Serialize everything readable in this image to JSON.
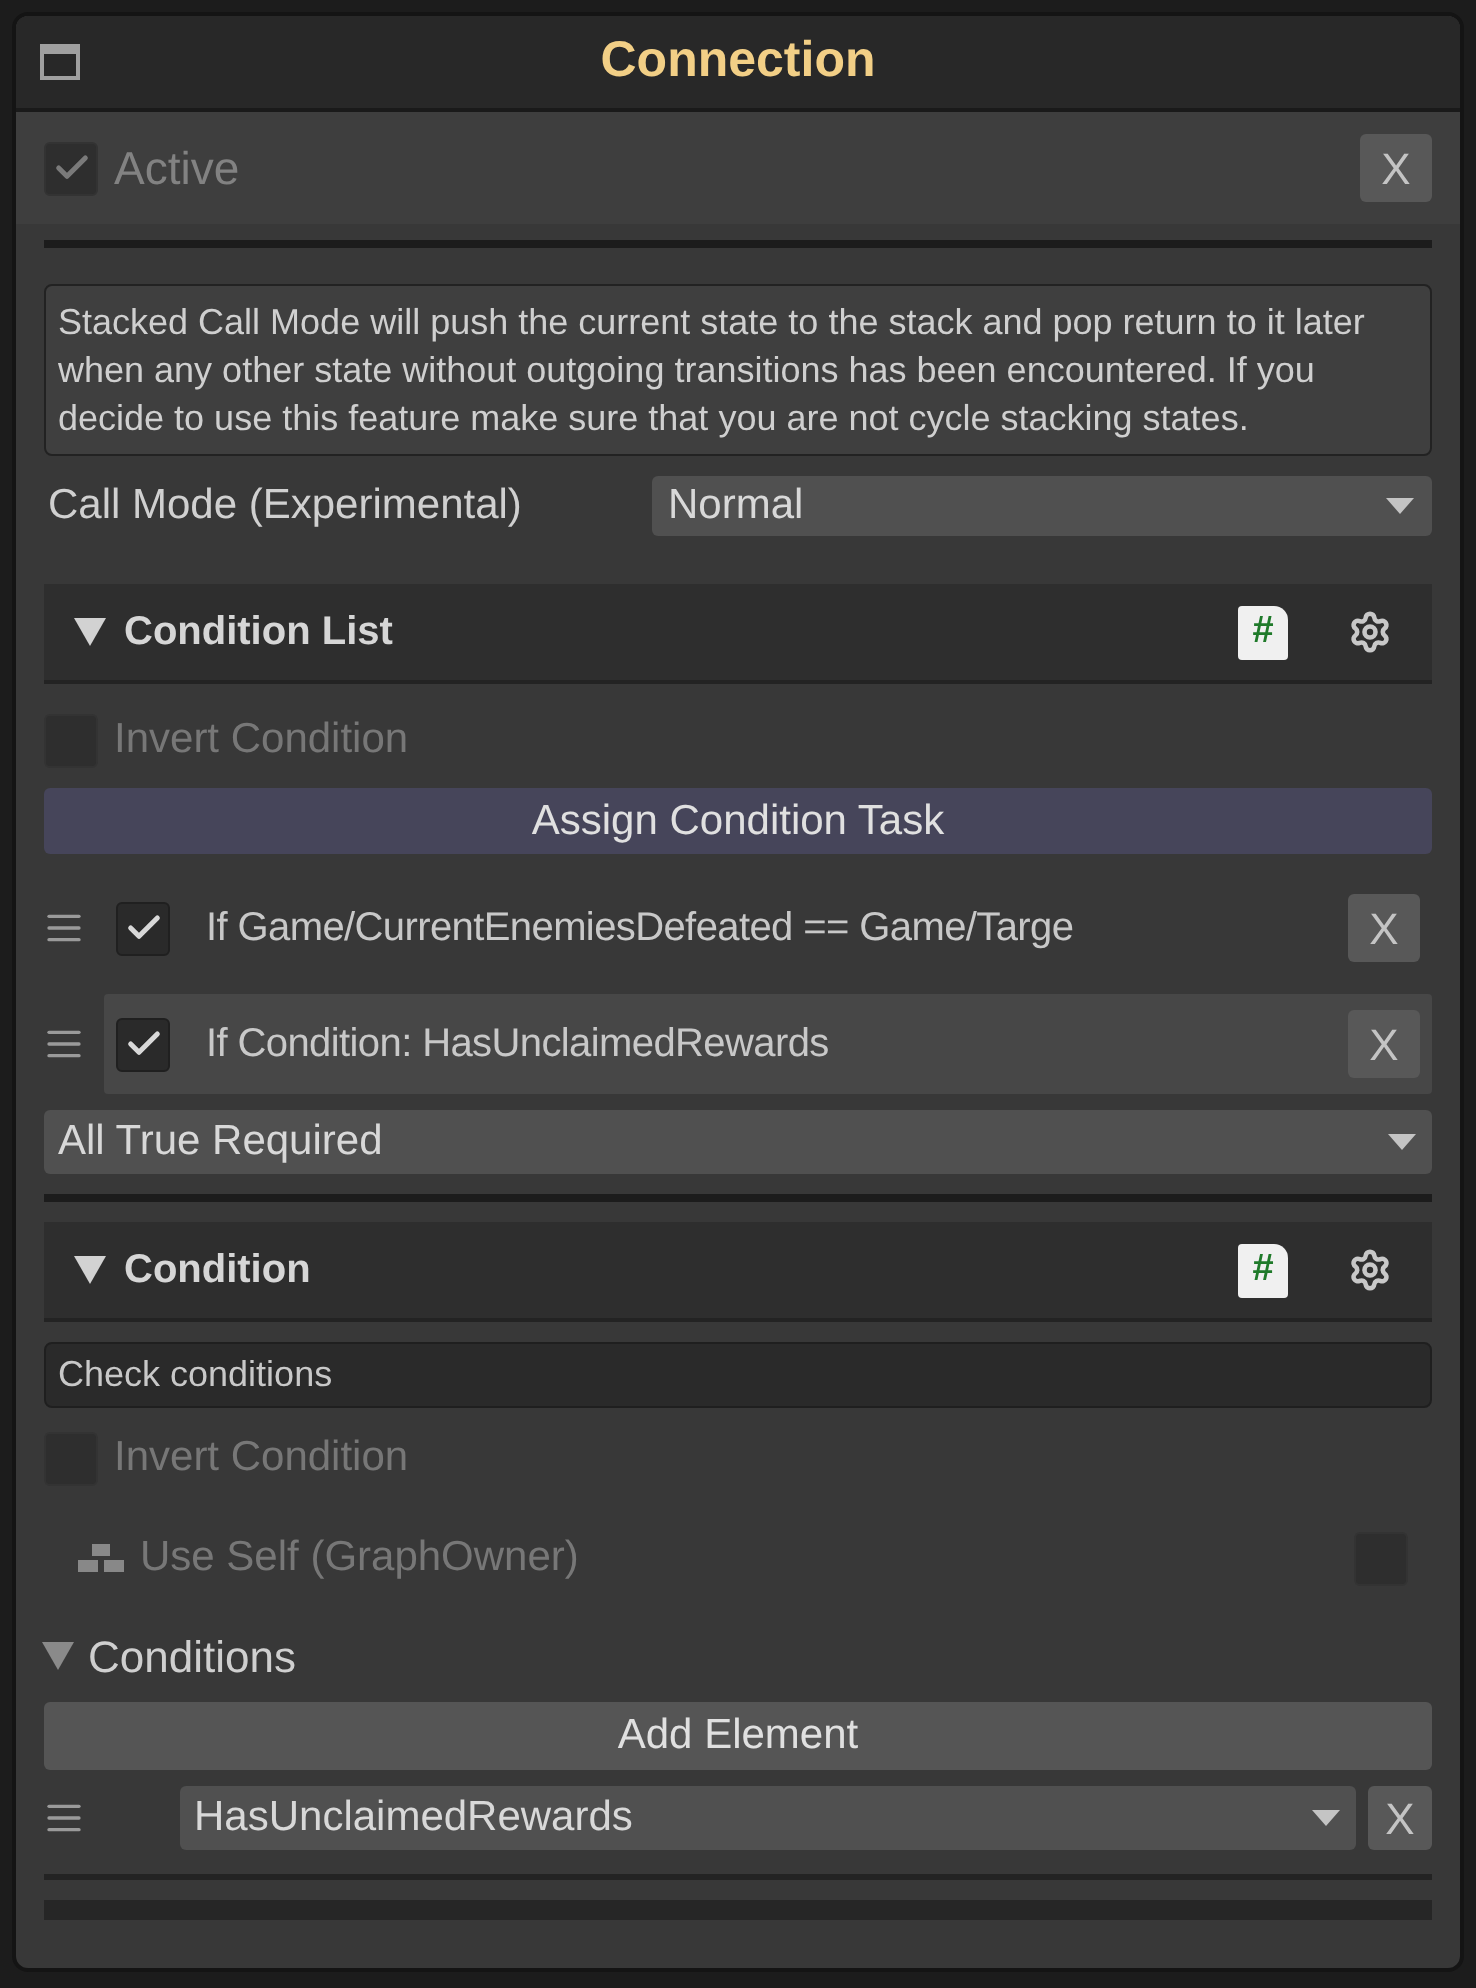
{
  "window": {
    "title": "Connection"
  },
  "active": {
    "label": "Active",
    "checked": true,
    "remove": "X"
  },
  "info": "Stacked Call Mode will push the current state to the stack and pop return to it later when any other state without outgoing transitions has been encountered. If you decide to use this feature make sure that you are not cycle stacking states.",
  "call_mode": {
    "label": "Call Mode (Experimental)",
    "value": "Normal"
  },
  "condition_list": {
    "title": "Condition List",
    "expanded": true,
    "script_badge": "#",
    "invert": {
      "label": "Invert Condition",
      "checked": false
    },
    "assign_button": "Assign Condition Task",
    "items": [
      {
        "text": "If Game/CurrentEnemiesDefeated == Game/Targe",
        "checked": true,
        "selected": false,
        "remove": "X"
      },
      {
        "text": "If Condition: HasUnclaimedRewards",
        "checked": true,
        "selected": true,
        "remove": "X"
      }
    ],
    "mode": "All True Required"
  },
  "condition": {
    "title": "Condition",
    "expanded": true,
    "script_badge": "#",
    "name": "Check conditions",
    "invert": {
      "label": "Invert Condition",
      "checked": false
    },
    "use_self": {
      "label": "Use Self (GraphOwner)",
      "checked": false
    },
    "conditions": {
      "label": "Conditions",
      "expanded": true,
      "add_button": "Add Element",
      "elements": [
        {
          "value": "HasUnclaimedRewards",
          "remove": "X"
        }
      ]
    }
  }
}
